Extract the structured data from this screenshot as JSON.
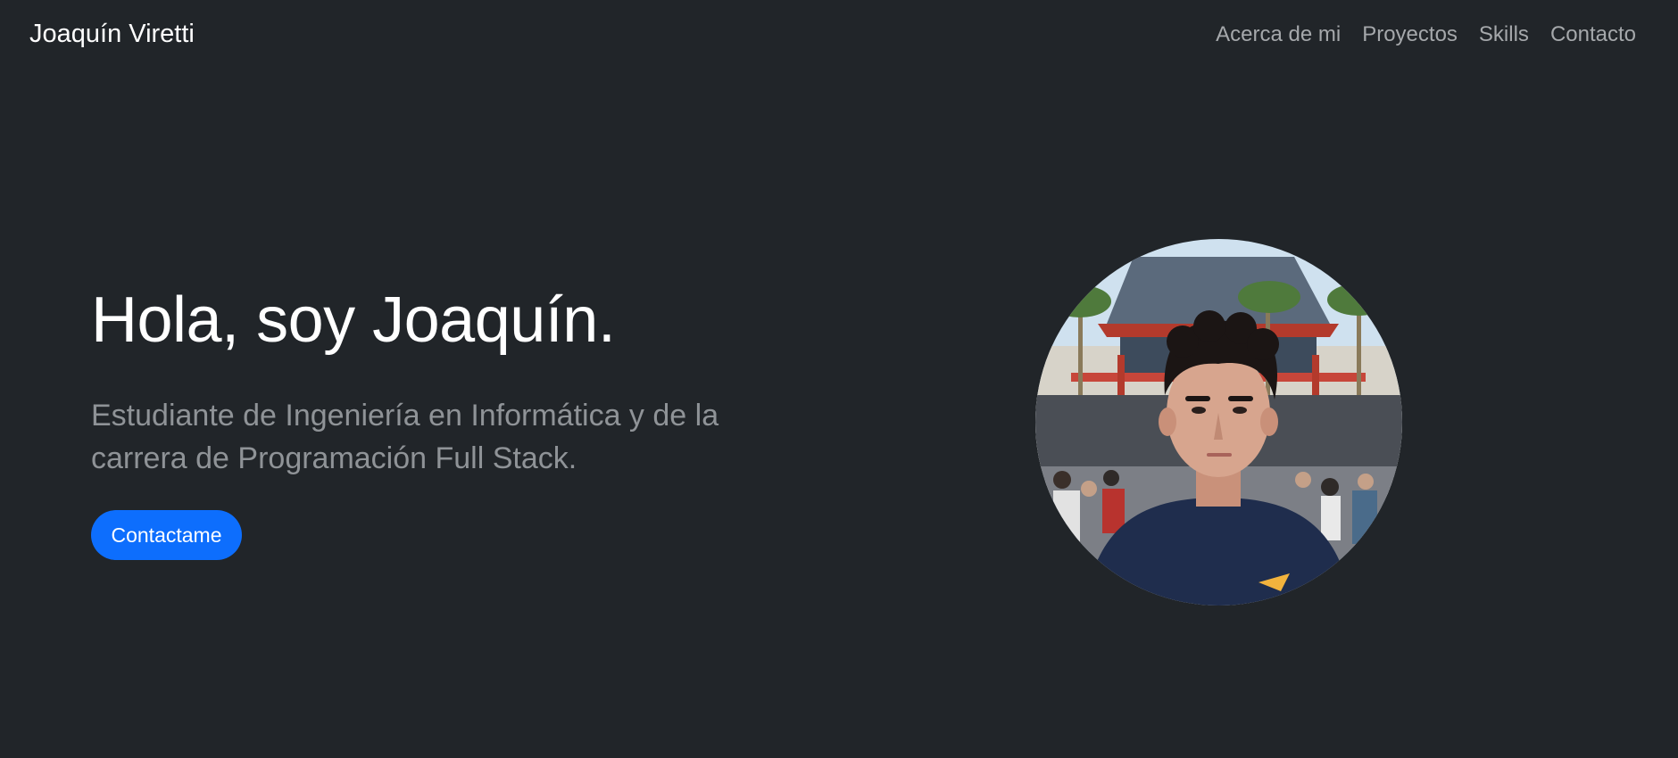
{
  "navbar": {
    "brand": "Joaquín Viretti",
    "links": [
      "Acerca de mi",
      "Proyectos",
      "Skills",
      "Contacto"
    ]
  },
  "hero": {
    "title": "Hola, soy Joaquín.",
    "subtitle": "Estudiante de Ingeniería en Informática y de la carrera de Programación Full Stack.",
    "cta_label": "Contactame"
  },
  "colors": {
    "background": "#212529",
    "accent": "#0d6efd",
    "nav_link": "#a5a8ab",
    "subtitle": "#8f9397"
  }
}
